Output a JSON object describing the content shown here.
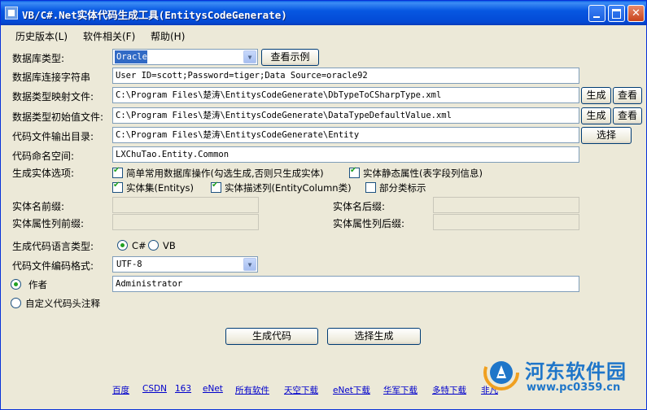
{
  "window": {
    "title": "VB/C#.Net实体代码生成工具(EntitysCodeGenerate)"
  },
  "menu": [
    {
      "label": "历史版本(L)"
    },
    {
      "label": "软件相关(F)"
    },
    {
      "label": "帮助(H)"
    }
  ],
  "form": {
    "db_type_label": "数据库类型:",
    "db_type_value": "Oracle",
    "view_example_button": "查看示例",
    "conn_label": "数据库连接字符串",
    "conn_value": "User ID=scott;Password=tiger;Data Source=oracle92",
    "type_map_label": "数据类型映射文件:",
    "type_map_value": "C:\\Program Files\\楚涛\\EntitysCodeGenerate\\DbTypeToCSharpType.xml",
    "type_init_label": "数据类型初始值文件:",
    "type_init_value": "C:\\Program Files\\楚涛\\EntitysCodeGenerate\\DataTypeDefaultValue.xml",
    "generate_button": "生成",
    "view_button": "查看",
    "output_dir_label": "代码文件输出目录:",
    "output_dir_value": "C:\\Program Files\\楚涛\\EntitysCodeGenerate\\Entity",
    "choose_button": "选择",
    "namespace_label": "代码命名空间:",
    "namespace_value": "LXChuTao.Entity.Common",
    "options_label": "生成实体选项:",
    "options": {
      "common_ops": {
        "label": "简单常用数据库操作(勾选生成,否则只生成实体)",
        "checked": true
      },
      "static_attr": {
        "label": "实体静态属性(表字段列信息)",
        "checked": true
      },
      "entity_set": {
        "label": "实体集(Entitys)",
        "checked": true
      },
      "desc_column": {
        "label": "实体描述列(EntityColumn类)",
        "checked": true
      },
      "partial_class": {
        "label": "部分类标示",
        "checked": false
      }
    },
    "prefix_label": "实体名前缀:",
    "suffix_label": "实体名后缀:",
    "prop_prefix_label": "实体属性列前缀:",
    "prop_suffix_label": "实体属性列后缀:",
    "language_label": "生成代码语言类型:",
    "language_options": [
      {
        "label": "C#",
        "selected": true
      },
      {
        "label": "VB",
        "selected": false
      }
    ],
    "encoding_label": "代码文件编码格式:",
    "encoding_value": "UTF-8",
    "author_radio": {
      "label": "作者",
      "selected": true
    },
    "author_value": "Administrator",
    "custom_header_radio": {
      "label": "自定义代码头注释",
      "selected": false
    },
    "generate_code_button": "生成代码",
    "select_generate_button": "选择生成"
  },
  "links": [
    "百度",
    "CSDN",
    "163",
    "eNet",
    "所有软件",
    "天空下载",
    "eNet下载",
    "华军下载",
    "多特下载",
    "非凡"
  ],
  "watermark": {
    "title": "河东软件园",
    "url": "www.pc0359.cn"
  },
  "colors": {
    "window_bg": "#ece9d8",
    "titlebar": "#0758e2",
    "link": "#0000cc",
    "check": "#21a121",
    "watermark": "#1f76c9"
  }
}
